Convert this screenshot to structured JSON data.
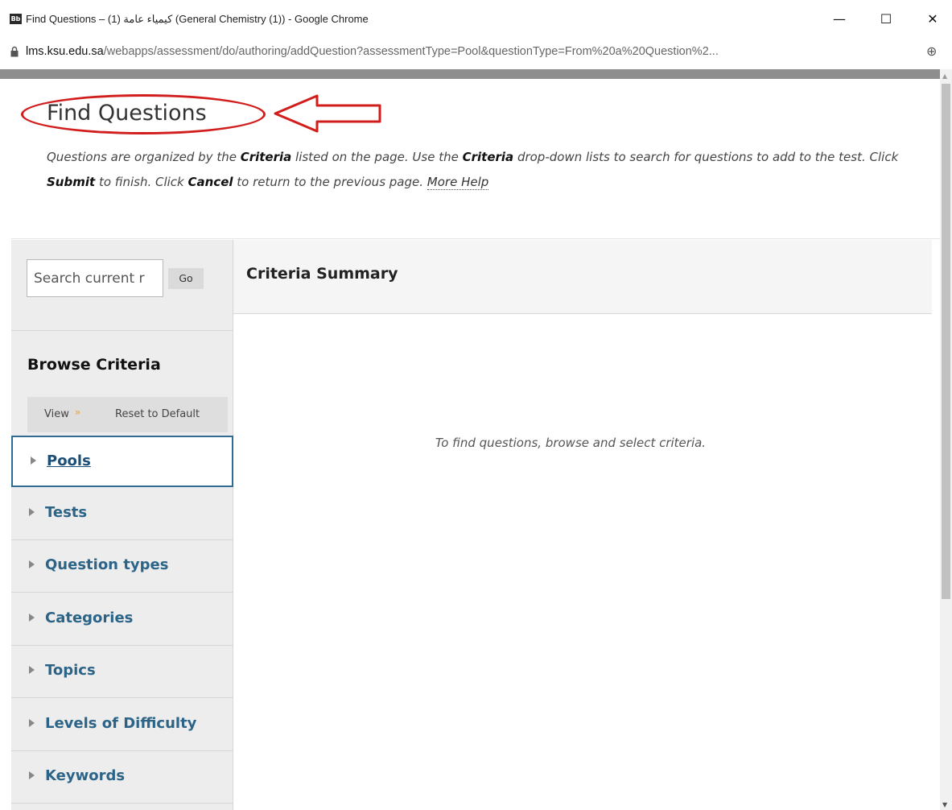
{
  "window": {
    "icon_text": "Bb",
    "title": "Find Questions – (1) كيمياء عامة (General Chemistry (1)) - Google Chrome",
    "minimize": "—",
    "maximize": "☐",
    "close": "✕"
  },
  "address_bar": {
    "host": "lms.ksu.edu.sa",
    "path": "/webapps/assessment/do/authoring/addQuestion?assessmentType=Pool&questionType=From%20a%20Question%2...",
    "zoom_icon": "zoom-icon"
  },
  "page": {
    "title": "Find Questions",
    "instructions": {
      "p1": "Questions are organized by the ",
      "b1": "Criteria",
      "p2": " listed on the page. Use the ",
      "b2": "Criteria",
      "p3": " drop-down lists to search for questions to add to the test. Click ",
      "b3": "Submit",
      "p4": " to finish. Click ",
      "b4": "Cancel",
      "p5": " to return to the previous page. ",
      "more_help": "More Help"
    }
  },
  "sidebar": {
    "search_placeholder": "Search current r",
    "go_label": "Go",
    "browse_title": "Browse Criteria",
    "view_label": "View",
    "reset_label": "Reset to Default",
    "items": [
      {
        "label": "Pools",
        "active": true
      },
      {
        "label": "Tests",
        "active": false
      },
      {
        "label": "Question types",
        "active": false
      },
      {
        "label": "Categories",
        "active": false
      },
      {
        "label": "Topics",
        "active": false
      },
      {
        "label": "Levels of Difficulty",
        "active": false
      },
      {
        "label": "Keywords",
        "active": false
      }
    ]
  },
  "main": {
    "summary_title": "Criteria Summary",
    "empty_message": "To find questions, browse and select criteria."
  },
  "colors": {
    "annotation": "#d21d1d",
    "link": "#2c6488",
    "view_chevron": "#e8a33a"
  }
}
